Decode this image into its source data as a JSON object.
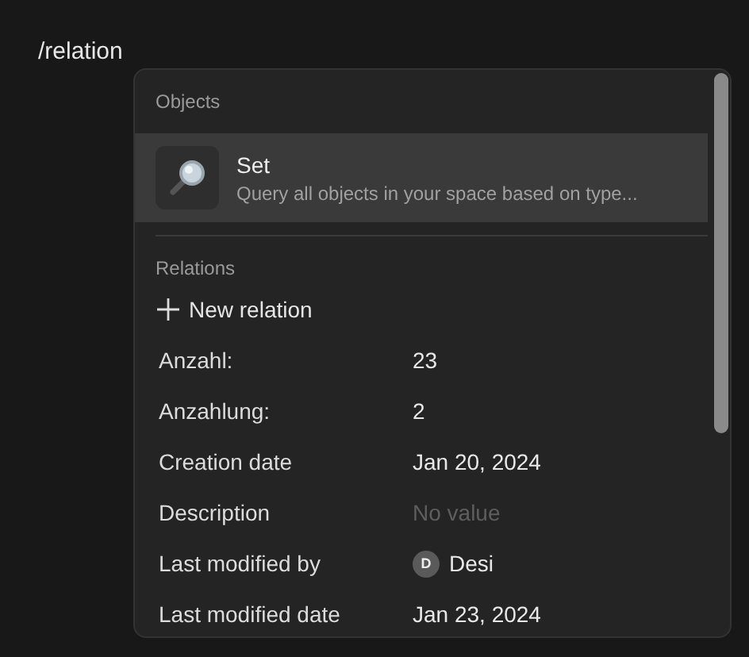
{
  "command": "/relation",
  "menu": {
    "sections": [
      {
        "title": "Objects",
        "items": [
          {
            "title": "Set",
            "description": "Query all objects in your space based on type...",
            "selected": true
          }
        ]
      },
      {
        "title": "Relations",
        "action": "New relation",
        "rows": [
          {
            "kind": "text",
            "label": "Anzahl:",
            "value": "23"
          },
          {
            "kind": "text",
            "label": "Anzahlung:",
            "value": "2"
          },
          {
            "kind": "text",
            "label": "Creation date",
            "value": "Jan 20, 2024"
          },
          {
            "kind": "empty",
            "label": "Description",
            "placeholder": "No value"
          },
          {
            "kind": "user",
            "label": "Last modified by",
            "initial": "D",
            "value": "Desi"
          },
          {
            "kind": "text",
            "label": "Last modified date",
            "value": "Jan 23, 2024"
          }
        ]
      }
    ]
  }
}
